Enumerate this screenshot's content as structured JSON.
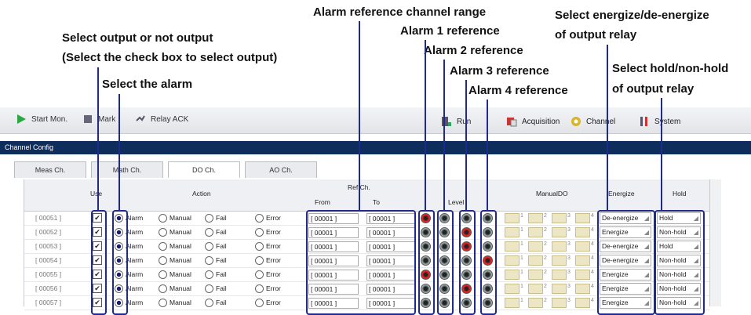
{
  "callouts": {
    "select_output": "Select output or not output",
    "select_output_sub": "(Select the check box to select output)",
    "select_alarm": "Select the alarm",
    "alarm_ref_range": "Alarm reference channel range",
    "alarm1": "Alarm 1 reference",
    "alarm2": "Alarm 2 reference",
    "alarm3": "Alarm 3 reference",
    "alarm4": "Alarm 4 reference",
    "energize_1": "Select energize/de-energize",
    "energize_2": "of output relay",
    "hold_1": "Select hold/non-hold",
    "hold_2": "of output relay"
  },
  "toolbar": {
    "start_mon": "Start Mon.",
    "mark": "Mark",
    "relay_ack": "Relay ACK"
  },
  "tabs": {
    "run": "Run",
    "acquisition": "Acquisition",
    "channel": "Channel",
    "system": "System"
  },
  "panel_title": "Channel Config",
  "subtabs": [
    "Meas Ch.",
    "Math Ch.",
    "DO Ch.",
    "AO Ch."
  ],
  "headers": {
    "use": "Use",
    "action": "Action",
    "refch": "Ref.Ch.",
    "from": "From",
    "to": "To",
    "level": "Level",
    "manualdo": "ManualDO",
    "energize": "Energize",
    "hold": "Hold"
  },
  "actions": [
    "Alarm",
    "Manual",
    "Fail",
    "Error"
  ],
  "manualdo_nums": [
    "1",
    "2",
    "3",
    "4"
  ],
  "rows": [
    {
      "ch": "[ 00051 ]",
      "from": "[ 00001 ]",
      "to": "[ 00001 ]",
      "energize": "De-energize",
      "hold": "Hold",
      "levels": [
        "red",
        "gray",
        "gray",
        "gray"
      ]
    },
    {
      "ch": "[ 00052 ]",
      "from": "[ 00001 ]",
      "to": "[ 00001 ]",
      "energize": "Energize",
      "hold": "Non-hold",
      "levels": [
        "gray",
        "gray",
        "red",
        "gray"
      ]
    },
    {
      "ch": "[ 00053 ]",
      "from": "[ 00001 ]",
      "to": "[ 00001 ]",
      "energize": "De-energize",
      "hold": "Hold",
      "levels": [
        "gray",
        "gray",
        "red",
        "gray"
      ]
    },
    {
      "ch": "[ 00054 ]",
      "from": "[ 00001 ]",
      "to": "[ 00001 ]",
      "energize": "De-energize",
      "hold": "Non-hold",
      "levels": [
        "gray",
        "gray",
        "gray",
        "red"
      ]
    },
    {
      "ch": "[ 00055 ]",
      "from": "[ 00001 ]",
      "to": "[ 00001 ]",
      "energize": "Energize",
      "hold": "Non-hold",
      "levels": [
        "red",
        "gray",
        "gray",
        "gray"
      ]
    },
    {
      "ch": "[ 00056 ]",
      "from": "[ 00001 ]",
      "to": "[ 00001 ]",
      "energize": "Energize",
      "hold": "Non-hold",
      "levels": [
        "gray",
        "gray",
        "red",
        "gray"
      ]
    },
    {
      "ch": "[ 00057 ]",
      "from": "[ 00001 ]",
      "to": "[ 00001 ]",
      "energize": "Energize",
      "hold": "Non-hold",
      "levels": [
        "gray",
        "gray",
        "gray",
        "gray"
      ]
    }
  ]
}
